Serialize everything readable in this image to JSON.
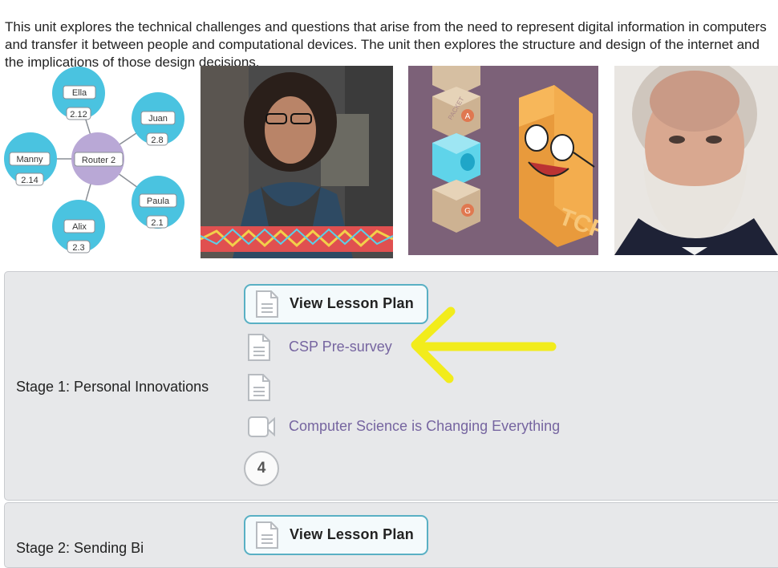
{
  "intro": {
    "text": "This unit explores the technical challenges and questions that arise from the need to represent digital information in computers and transfer it between people and computational devices. The unit then explores the structure and design of the internet and the implications of those design decisions."
  },
  "diagram": {
    "router": "Router 2",
    "nodes": [
      {
        "name": "Ella",
        "addr": "2.12"
      },
      {
        "name": "Juan",
        "addr": "2.8"
      },
      {
        "name": "Manny",
        "addr": "2.14"
      },
      {
        "name": "Paula",
        "addr": "2.1"
      },
      {
        "name": "Alix",
        "addr": "2.3"
      }
    ]
  },
  "illustration": {
    "packet_label": "PACKET",
    "packet_letters": [
      "A",
      "G"
    ],
    "box_label": "TCP"
  },
  "stages": [
    {
      "title": "Stage 1: Personal Innovations",
      "lesson_plan_label": "View Lesson Plan",
      "items": [
        {
          "type": "document",
          "label": "CSP Pre-survey"
        },
        {
          "type": "document",
          "label": ""
        },
        {
          "type": "video",
          "label": "Computer Science is Changing Everything"
        }
      ],
      "badge": "4"
    },
    {
      "title": "Stage 2: Sending Bi",
      "lesson_plan_label": "View Lesson Plan"
    }
  ],
  "colors": {
    "link": "#7665a0",
    "button_border": "#59b0c4",
    "stage_bg": "#e7e8ea",
    "annotation_arrow": "#f2ec1c"
  }
}
